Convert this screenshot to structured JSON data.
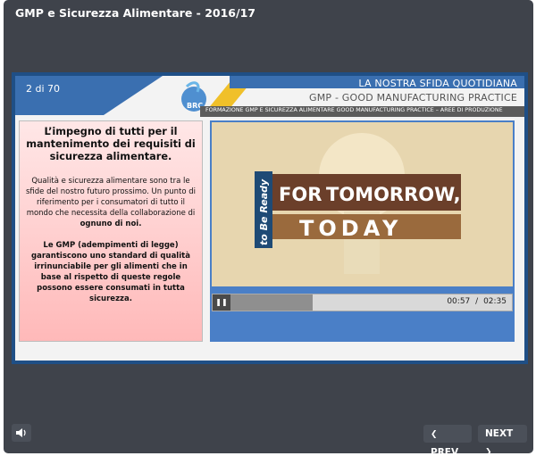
{
  "window": {
    "title": "GMP e Sicurezza Alimentare - 2016/17"
  },
  "slide": {
    "page_counter": "2 di 70",
    "header": {
      "line1": "LA NOSTRA SFIDA QUOTIDIANA",
      "line2": "GMP - GOOD MANUFACTURING PRACTICE",
      "band": "FORMAZIONE GMP E SICUREZZA ALIMENTARE GOOD MANUFACTURING PRACTICE – AREE DI  PRODUZIONE",
      "logo_text": "BRC"
    },
    "text_panel": {
      "heading": "L’impegno di tutti per il mantenimento dei requisiti di sicurezza alimentare.",
      "para1": "Qualità e sicurezza alimentare sono tra le sfide del nostro futuro prossimo.",
      "para2_pre": "Un punto di riferimento per i consumatori di tutto il mondo che necessita della collaborazione di ",
      "para2_bold": "ognuno di noi.",
      "para3": "Le GMP (adempimenti di legge) garantiscono uno standard di qualità irrinunciabile per gli alimenti che in base al rispetto di queste regole possono essere consumati in tutta sicurezza."
    },
    "video": {
      "title_tag": "to Be Ready",
      "title_for": "FOR",
      "title_tomorrow": "TOMORROW,",
      "title_today": "TODAY",
      "current_time": "00:57",
      "time_separator": "/",
      "duration": "02:35",
      "progress_fraction": 0.368,
      "pause_icon": "pause-icon"
    }
  },
  "controls": {
    "prev_label": "PREV",
    "next_label": "NEXT",
    "volume_icon": "volume-icon"
  },
  "colors": {
    "player_bg": "#3f434b",
    "slide_border": "#1f4f86",
    "header_blue": "#3a6fb0",
    "accent_yellow": "#f0c02a",
    "panel_pink": "#ffb9b9",
    "video_banner": "#6b3f2a"
  }
}
